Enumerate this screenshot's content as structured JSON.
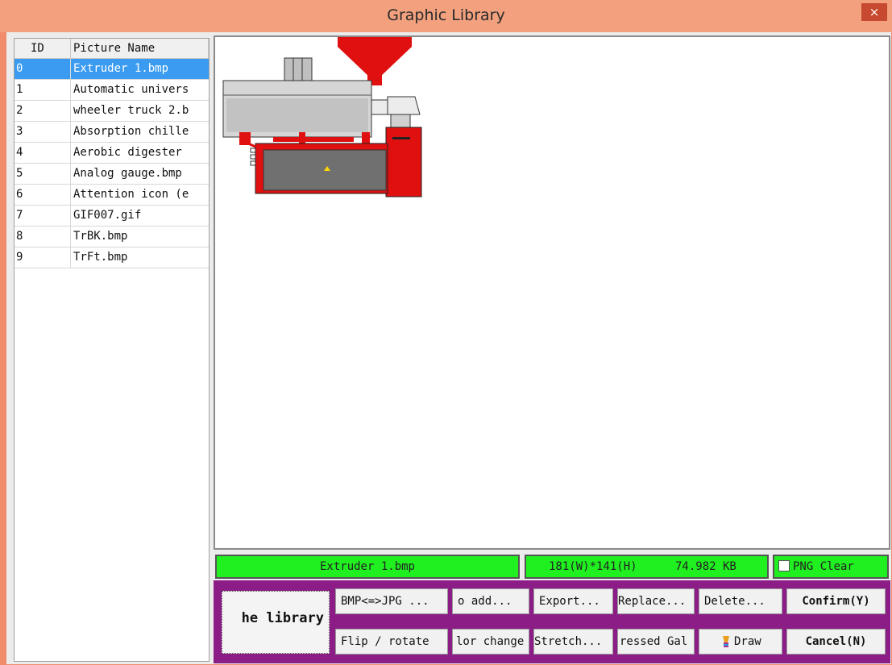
{
  "window": {
    "title": "Graphic Library",
    "close_glyph": "×"
  },
  "list": {
    "headers": {
      "id": "ID",
      "name": "Picture Name"
    },
    "rows": [
      {
        "id": "0",
        "name": "Extruder 1.bmp",
        "selected": true
      },
      {
        "id": "1",
        "name": "Automatic univers"
      },
      {
        "id": "2",
        "name": "wheeler truck 2.b"
      },
      {
        "id": "3",
        "name": "Absorption chille"
      },
      {
        "id": "4",
        "name": "Aerobic digester"
      },
      {
        "id": "5",
        "name": "Analog gauge.bmp"
      },
      {
        "id": "6",
        "name": "Attention icon (e"
      },
      {
        "id": "7",
        "name": "GIF007.gif"
      },
      {
        "id": "8",
        "name": "TrBK.bmp"
      },
      {
        "id": "9",
        "name": "TrFt.bmp"
      }
    ]
  },
  "preview": {
    "image_name": "extruder-machine"
  },
  "status": {
    "filename": "Extruder 1.bmp",
    "dimensions": "181(W)*141(H)",
    "size": "74.982 KB",
    "png_clear_label": "PNG Clear",
    "png_clear_checked": false
  },
  "toolbar": {
    "library": "he library",
    "bmp_jpg": "BMP<=>JPG ...",
    "add": "o add...",
    "export": "Export...",
    "replace": "Replace...",
    "delete": "Delete...",
    "confirm": "Confirm(Y)",
    "flip_rotate": "Flip / rotate",
    "color_change": "lor change",
    "stretch": "Stretch...",
    "compressed": "ressed Gal",
    "draw": "Draw",
    "cancel": "Cancel(N)"
  },
  "colors": {
    "title_bar": "#f2a07d",
    "status_green": "#20f020",
    "toolbar_purple": "#8c1d86",
    "selection": "#3a9bf0"
  }
}
